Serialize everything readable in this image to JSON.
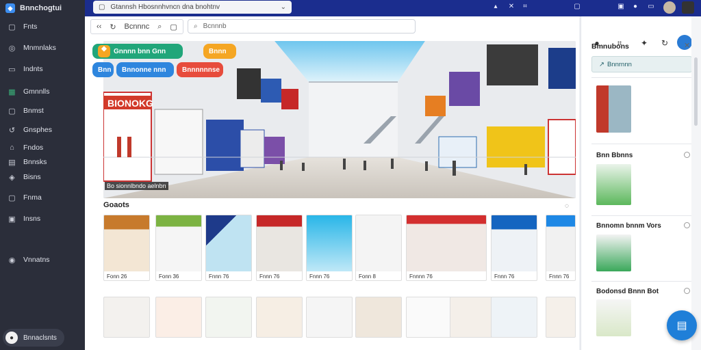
{
  "app": {
    "brand": "Bnnchogtui"
  },
  "sidebar": {
    "items": [
      {
        "label": "Fnts",
        "icon": "file-icon",
        "glyph": "▢"
      },
      {
        "label": "Mnmnlaks",
        "icon": "globe-icon",
        "glyph": "◎"
      },
      {
        "label": "Indnts",
        "icon": "document-icon",
        "glyph": "▭"
      },
      {
        "label": "Gmnnlls",
        "icon": "spreadsheet-icon",
        "glyph": "▦"
      },
      {
        "label": "Bnmst",
        "icon": "calendar-icon",
        "glyph": "▢"
      },
      {
        "label": "Gnsphes",
        "icon": "chart-icon",
        "glyph": "↺"
      },
      {
        "label": "Fndos",
        "icon": "folder-icon",
        "glyph": "⌂"
      },
      {
        "label": "Bnnsks",
        "icon": "list-icon",
        "glyph": "▤"
      },
      {
        "label": "Bisns",
        "icon": "tag-icon",
        "glyph": "◈"
      },
      {
        "label": "Fnma",
        "icon": "image-icon",
        "glyph": "▢"
      },
      {
        "label": "Insns",
        "icon": "box-icon",
        "glyph": "▣"
      },
      {
        "label": "Vnnatns",
        "icon": "settings-icon",
        "glyph": "◉"
      }
    ],
    "user_label": "Bnnaclsnts"
  },
  "topbar": {
    "url_text": "Gtannsh Hbosnnhvncn dna bnohtnv",
    "icons": [
      "caret-icon",
      "close-icon",
      "extension-icon",
      "chat-icon",
      "window-icon",
      "record-icon",
      "avatar",
      "profile-avatar"
    ]
  },
  "toolbar": {
    "nav_text": "Bcnnnc",
    "search_placeholder": "Bcnnnb"
  },
  "hero": {
    "caption": "Bo sionnlbndo aelnbn",
    "store_sign": "BIONOKG",
    "pills": [
      {
        "label": "Gnnnn bnn Gnn",
        "color": "#21a67a"
      },
      {
        "label": "Bnnn",
        "color": "#f5a623"
      },
      {
        "label": "Bnn",
        "color": "#2e86de"
      },
      {
        "label": "Bnnonne nnn",
        "color": "#2e86de"
      },
      {
        "label": "Bnnnnnnse",
        "color": "#e74c3c"
      }
    ]
  },
  "results": {
    "title": "Goaots",
    "row1": [
      {
        "label": "Fonn 26"
      },
      {
        "label": "Fonn 36"
      },
      {
        "label": "Fnnn 76"
      },
      {
        "label": "Fnnn 76"
      },
      {
        "label": "Fnnn 76"
      },
      {
        "label": "Fonn 8"
      },
      {
        "label": "Fnnnn 76"
      },
      {
        "label": "Fnnn 76"
      },
      {
        "label": "Fnnn 76"
      }
    ]
  },
  "panel": {
    "title": "Bmnubons",
    "button": "Bnnrnnn",
    "cards": [
      {
        "title": ""
      },
      {
        "title": "Bnn Bbnns"
      },
      {
        "title": "Bnnomn bnnm Vors"
      },
      {
        "title": "Bodonsd Bnnn Bot"
      }
    ]
  },
  "colors": {
    "sidebar": "#2b2e3a",
    "topbar": "#1b2d8e",
    "accent": "#1f7fd8"
  }
}
